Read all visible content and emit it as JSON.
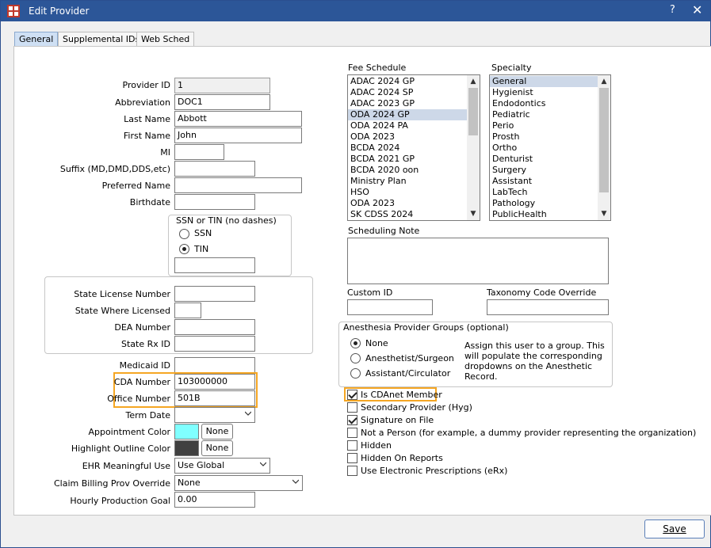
{
  "window": {
    "title": "Edit Provider",
    "help_label": "?",
    "close_label": "✕"
  },
  "tabs": [
    {
      "label": "General",
      "active": true
    },
    {
      "label": "Supplemental IDs",
      "active": false
    },
    {
      "label": "Web Sched",
      "active": false
    }
  ],
  "fields": {
    "provider_id": {
      "label": "Provider ID",
      "value": "1"
    },
    "abbreviation": {
      "label": "Abbreviation",
      "value": "DOC1"
    },
    "last_name": {
      "label": "Last Name",
      "value": "Abbott"
    },
    "first_name": {
      "label": "First Name",
      "value": "John"
    },
    "mi": {
      "label": "MI",
      "value": ""
    },
    "suffix": {
      "label": "Suffix (MD,DMD,DDS,etc)",
      "value": ""
    },
    "preferred_name": {
      "label": "Preferred Name",
      "value": ""
    },
    "birthdate": {
      "label": "Birthdate",
      "value": ""
    }
  },
  "ssn_group": {
    "title": "SSN or TIN (no dashes)",
    "ssn_label": "SSN",
    "tin_label": "TIN",
    "selected": "TIN",
    "value": ""
  },
  "license_group": {
    "state_license": {
      "label": "State License Number",
      "value": ""
    },
    "state_where": {
      "label": "State Where Licensed",
      "value": ""
    },
    "dea": {
      "label": "DEA Number",
      "value": ""
    },
    "state_rx": {
      "label": "State Rx ID",
      "value": ""
    }
  },
  "medicaid_id": {
    "label": "Medicaid ID",
    "value": ""
  },
  "cda_number": {
    "label": "CDA Number",
    "value": "103000000"
  },
  "office_number": {
    "label": "Office Number",
    "value": "501B"
  },
  "term_date": {
    "label": "Term Date",
    "value": ""
  },
  "appointment_color": {
    "label": "Appointment Color",
    "color": "#80ffff",
    "button": "None"
  },
  "highlight_color": {
    "label": "Highlight Outline Color",
    "color": "#404040",
    "button": "None"
  },
  "ehr_use": {
    "label": "EHR Meaningful Use",
    "value": "Use Global"
  },
  "claim_billing": {
    "label": "Claim Billing Prov Override",
    "value": "None"
  },
  "hourly_goal": {
    "label": "Hourly Production Goal",
    "value": "0.00"
  },
  "fee_schedule": {
    "label": "Fee Schedule",
    "items": [
      "ADAC 2024 GP",
      "ADAC 2024 SP",
      "ADAC 2023 GP",
      "ODA 2024 GP",
      "ODA 2024 PA",
      "ODA 2023",
      "BCDA  2024",
      "BCDA 2021 GP",
      "BCDA 2020 oon",
      "Ministry Plan",
      "HSO",
      "ODA 2023",
      "SK CDSS 2024"
    ],
    "selected_index": 3
  },
  "specialty": {
    "label": "Specialty",
    "items": [
      "General",
      "Hygienist",
      "Endodontics",
      "Pediatric",
      "Perio",
      "Prosth",
      "Ortho",
      "Denturist",
      "Surgery",
      "Assistant",
      "LabTech",
      "Pathology",
      "PublicHealth"
    ],
    "selected_index": 0
  },
  "scheduling_note": {
    "label": "Scheduling Note",
    "value": ""
  },
  "custom_id": {
    "label": "Custom ID",
    "value": ""
  },
  "taxonomy": {
    "label": "Taxonomy Code Override",
    "value": ""
  },
  "anesthesia": {
    "title": "Anesthesia Provider Groups (optional)",
    "options": [
      "None",
      "Anesthetist/Surgeon",
      "Assistant/Circulator"
    ],
    "selected": "None",
    "note": "Assign this user to a group. This will populate the corresponding dropdowns on the Anesthetic Record."
  },
  "checkboxes": [
    {
      "label": "Is CDAnet Member",
      "checked": true
    },
    {
      "label": "Secondary Provider (Hyg)",
      "checked": false
    },
    {
      "label": "Signature on File",
      "checked": true
    },
    {
      "label": "Not a Person (for example, a dummy provider representing the organization)",
      "checked": false
    },
    {
      "label": "Hidden",
      "checked": false
    },
    {
      "label": "Hidden On Reports",
      "checked": false
    },
    {
      "label": "Use Electronic Prescriptions (eRx)",
      "checked": false
    }
  ],
  "save_button": {
    "label": "Save"
  }
}
